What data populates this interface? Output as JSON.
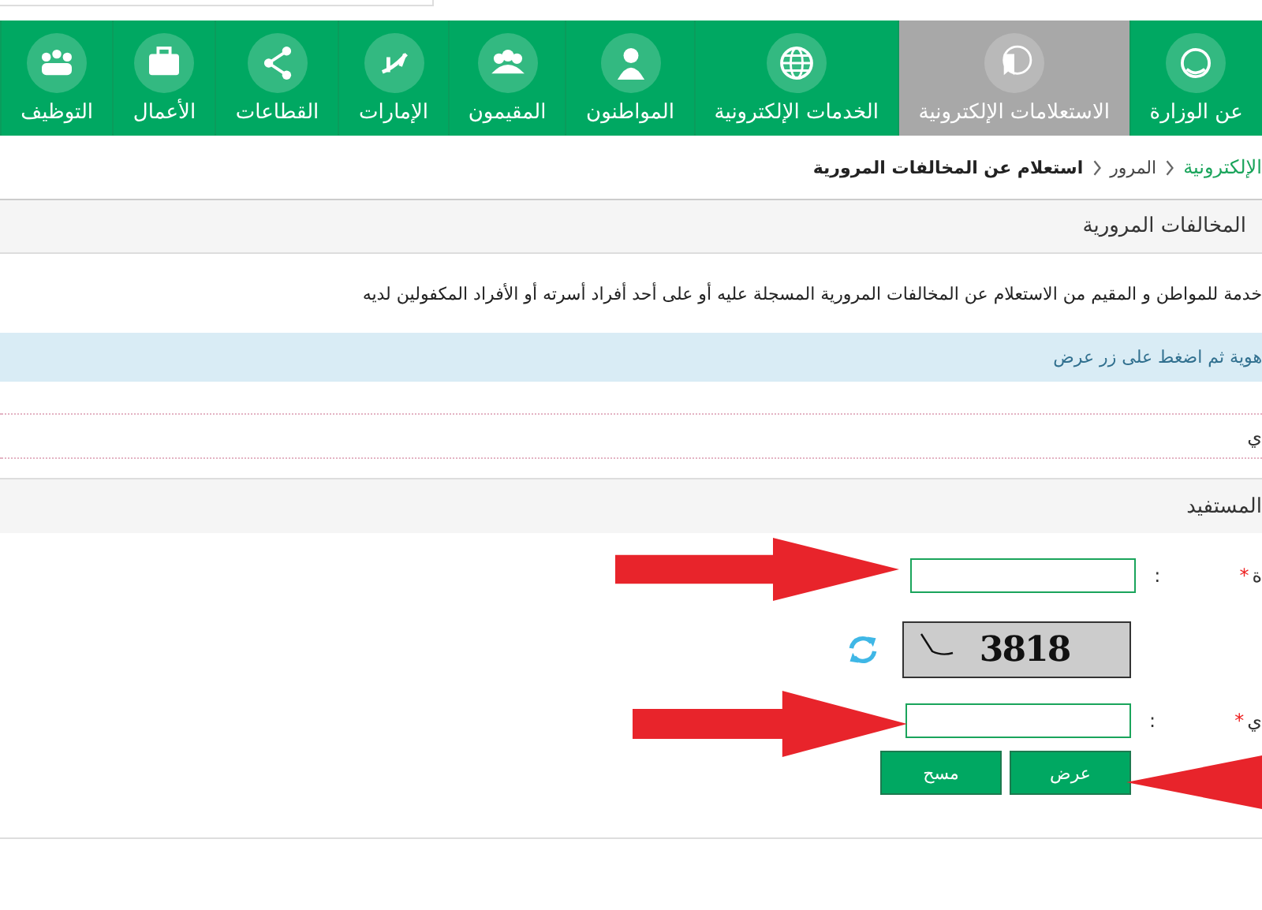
{
  "nav": [
    {
      "label": "عن الوزارة",
      "selected": false
    },
    {
      "label": "الاستعلامات الإلكترونية",
      "selected": true
    },
    {
      "label": "الخدمات الإلكترونية",
      "selected": false
    },
    {
      "label": "المواطنون",
      "selected": false
    },
    {
      "label": "المقيمون",
      "selected": false
    },
    {
      "label": "الإمارات",
      "selected": false
    },
    {
      "label": "القطاعات",
      "selected": false
    },
    {
      "label": "الأعمال",
      "selected": false
    },
    {
      "label": "التوظيف",
      "selected": false
    }
  ],
  "breadcrumb": [
    {
      "label": "الإلكترونية",
      "kind": "link"
    },
    {
      "label": "المرور",
      "kind": "link"
    },
    {
      "label": "استعلام عن المخالفات المرورية",
      "kind": "current"
    }
  ],
  "panel_title": "المخالفات المرورية",
  "description": "خدمة للمواطن و المقيم من الاستعلام عن المخالفات المرورية المسجلة عليه أو على أحد أفراد أسرته أو الأفراد المكفولين لديه",
  "info": "هوية ثم اضغط على زر عرض",
  "option_label": "ي",
  "section_title": "المستفيد",
  "form": [
    {
      "kind": "input",
      "label": "ة",
      "required_mark": "*",
      "colon": ":"
    },
    {
      "kind": "captcha",
      "code": "3818"
    },
    {
      "kind": "input",
      "label": "ي",
      "required_mark": "*",
      "colon": ":"
    }
  ],
  "buttons": [
    "عرض",
    "مسح"
  ]
}
